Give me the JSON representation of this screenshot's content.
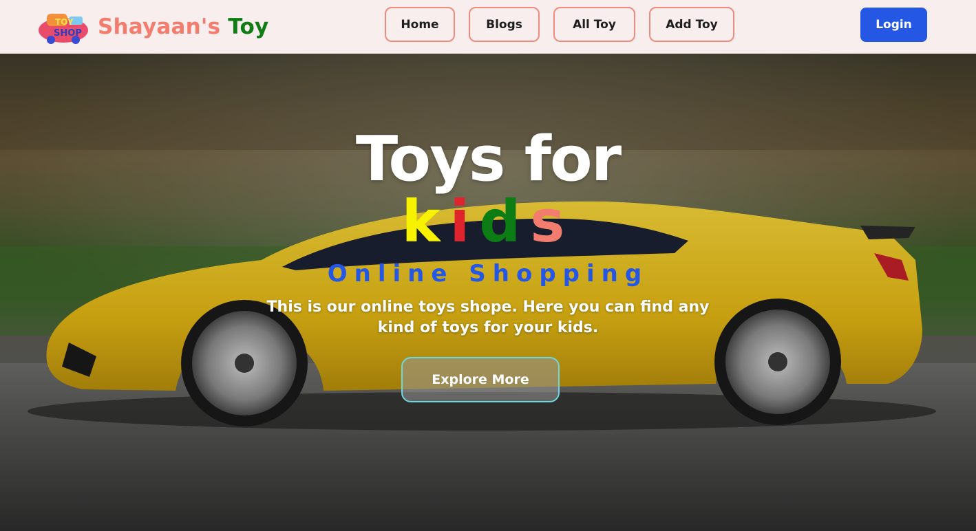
{
  "brand": {
    "name_part1": "Shayaan's",
    "name_part2": "Toy",
    "logo_icon": "toy-shop-logo-icon",
    "logo_text_top": "TOY",
    "logo_text_bottom": "SHOP"
  },
  "nav": {
    "items": [
      {
        "label": "Home"
      },
      {
        "label": "Blogs"
      },
      {
        "label": "All Toy"
      },
      {
        "label": "Add Toy"
      }
    ],
    "login_label": "Login"
  },
  "hero": {
    "title_line1": "Toys for",
    "kids_letters": [
      "k",
      "i",
      "d",
      "s"
    ],
    "subtitle": "Online Shopping",
    "description": "This is our online toys shope. Here you can find any kind of toys for your kids.",
    "cta_label": "Explore More",
    "background_image": "yellow-toy-sports-car-photo"
  },
  "colors": {
    "brand_coral": "#f27d6e",
    "brand_green": "#0f7d14",
    "login_blue": "#2357e4",
    "nav_border": "#f08a7c",
    "kids_yellow": "#f7f200",
    "kids_red": "#e0242e",
    "kids_green": "#0b7d14",
    "kids_coral": "#f27d6e",
    "subtitle_blue": "#2457e6",
    "cta_border": "#6fd6e0"
  }
}
